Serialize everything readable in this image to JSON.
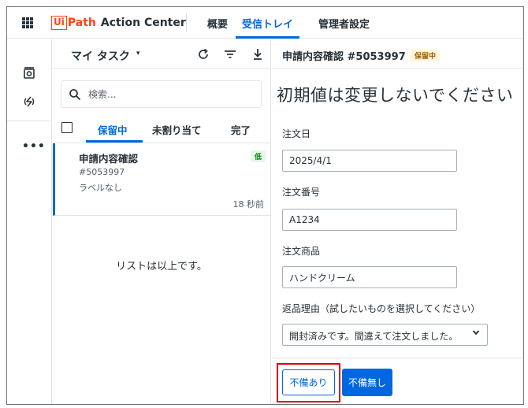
{
  "header": {
    "logo_ui": "Ui",
    "logo_path": "Path",
    "app_name": "Action Center",
    "tabs": [
      {
        "label": "概要"
      },
      {
        "label": "受信トレイ"
      },
      {
        "label": "管理者設定"
      }
    ],
    "active_tab": "受信トレイ"
  },
  "rail": {
    "icons": [
      "tasks-icon",
      "processes-icon"
    ],
    "more": "•••"
  },
  "task_list": {
    "title": "マイ タスク",
    "caret": "▾",
    "search_placeholder": "検索...",
    "tabs": [
      {
        "label": "保留中"
      },
      {
        "label": "未割り当て"
      },
      {
        "label": "完了"
      }
    ],
    "active_tab": "保留中",
    "card": {
      "title": "申請内容確認",
      "priority": "低",
      "id": "#5053997",
      "label": "ラベルなし",
      "time": "18 秒前"
    },
    "end_text": "リストは以上です。"
  },
  "detail": {
    "title": "申請内容確認 #5053997",
    "status": "保留中",
    "form_title": "初期値は変更しないでください",
    "fields": [
      {
        "label": "注文日",
        "value": "2025/4/1"
      },
      {
        "label": "注文番号",
        "value": "A1234"
      },
      {
        "label": "注文商品",
        "value": "ハンドクリーム"
      }
    ],
    "reason": {
      "label": "返品理由（試したいものを選択してください）",
      "selected": "開封済みです。間違えて注文しました。"
    },
    "buttons": {
      "defect": "不備あり",
      "no_defect": "不備無し"
    }
  },
  "colors": {
    "accent": "#0067df",
    "brand": "#fa4616",
    "highlight": "#e0000e"
  }
}
